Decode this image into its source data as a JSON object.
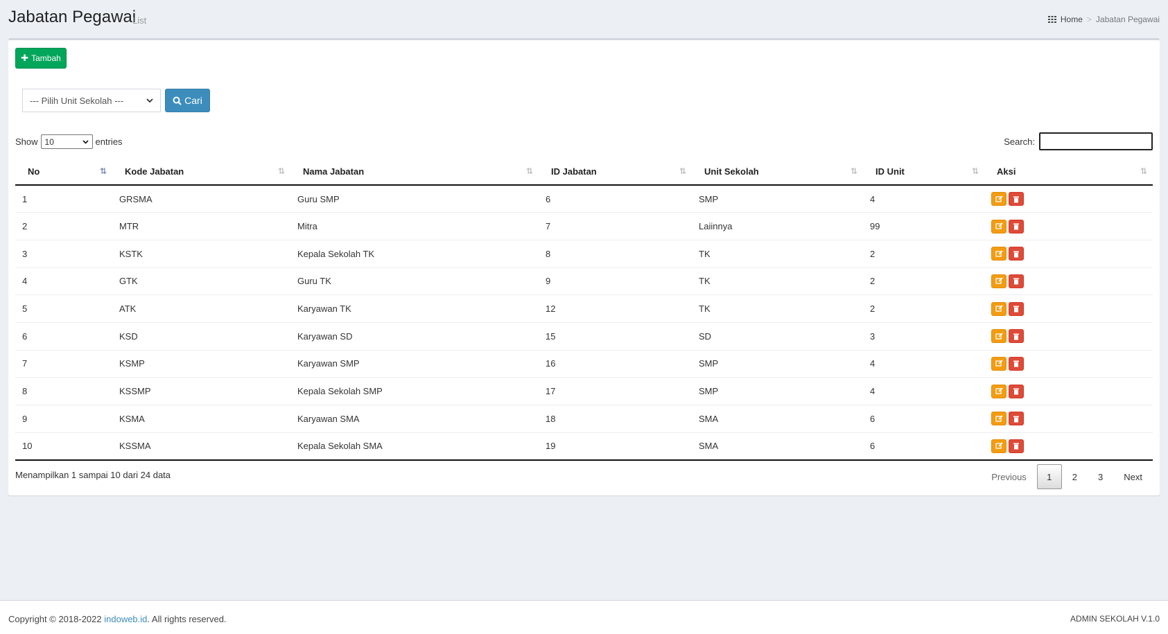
{
  "header": {
    "title": "Jabatan Pegawai",
    "subtitle": "List",
    "breadcrumb": {
      "home": "Home",
      "separator": ">",
      "current": "Jabatan Pegawai"
    }
  },
  "toolbar": {
    "add_label": "Tambah",
    "add_icon": "plus-icon"
  },
  "filter": {
    "unit_select_value": "--- Pilih Unit Sekolah ---",
    "search_button_label": "Cari",
    "search_icon": "search-icon"
  },
  "datatable": {
    "show_label": "Show",
    "entries_value": "10",
    "entries_label": "entries",
    "search_label": "Search:",
    "search_value": ""
  },
  "table": {
    "columns": [
      "No",
      "Kode Jabatan",
      "Nama Jabatan",
      "ID Jabatan",
      "Unit Sekolah",
      "ID Unit",
      "Aksi"
    ],
    "rows": [
      {
        "no": "1",
        "kode": "GRSMA",
        "nama": "Guru SMP",
        "id_jabatan": "6",
        "unit": "SMP",
        "id_unit": "4"
      },
      {
        "no": "2",
        "kode": "MTR",
        "nama": "Mitra",
        "id_jabatan": "7",
        "unit": "Laiinnya",
        "id_unit": "99"
      },
      {
        "no": "3",
        "kode": "KSTK",
        "nama": "Kepala Sekolah TK",
        "id_jabatan": "8",
        "unit": "TK",
        "id_unit": "2"
      },
      {
        "no": "4",
        "kode": "GTK",
        "nama": "Guru TK",
        "id_jabatan": "9",
        "unit": "TK",
        "id_unit": "2"
      },
      {
        "no": "5",
        "kode": "ATK",
        "nama": "Karyawan TK",
        "id_jabatan": "12",
        "unit": "TK",
        "id_unit": "2"
      },
      {
        "no": "6",
        "kode": "KSD",
        "nama": "Karyawan SD",
        "id_jabatan": "15",
        "unit": "SD",
        "id_unit": "3"
      },
      {
        "no": "7",
        "kode": "KSMP",
        "nama": "Karyawan SMP",
        "id_jabatan": "16",
        "unit": "SMP",
        "id_unit": "4"
      },
      {
        "no": "8",
        "kode": "KSSMP",
        "nama": "Kepala Sekolah SMP",
        "id_jabatan": "17",
        "unit": "SMP",
        "id_unit": "4"
      },
      {
        "no": "9",
        "kode": "KSMA",
        "nama": "Karyawan SMA",
        "id_jabatan": "18",
        "unit": "SMA",
        "id_unit": "6"
      },
      {
        "no": "10",
        "kode": "KSSMA",
        "nama": "Kepala Sekolah SMA",
        "id_jabatan": "19",
        "unit": "SMA",
        "id_unit": "6"
      }
    ]
  },
  "info_text": "Menampilkan 1 sampai 10 dari 24 data",
  "pagination": {
    "previous": "Previous",
    "pages": [
      "1",
      "2",
      "3"
    ],
    "current": "1",
    "next": "Next"
  },
  "footer": {
    "copyright_prefix": "Copyright © 2018-2022 ",
    "link_text": "indoweb.id",
    "copyright_suffix": ". All rights reserved.",
    "version": "ADMIN SEKOLAH V.1.0"
  },
  "colors": {
    "add_button": "#00a65a",
    "search_button": "#3c8dbc",
    "edit_button": "#f39c12",
    "delete_button": "#dd4b39",
    "background": "#ecf0f5"
  }
}
